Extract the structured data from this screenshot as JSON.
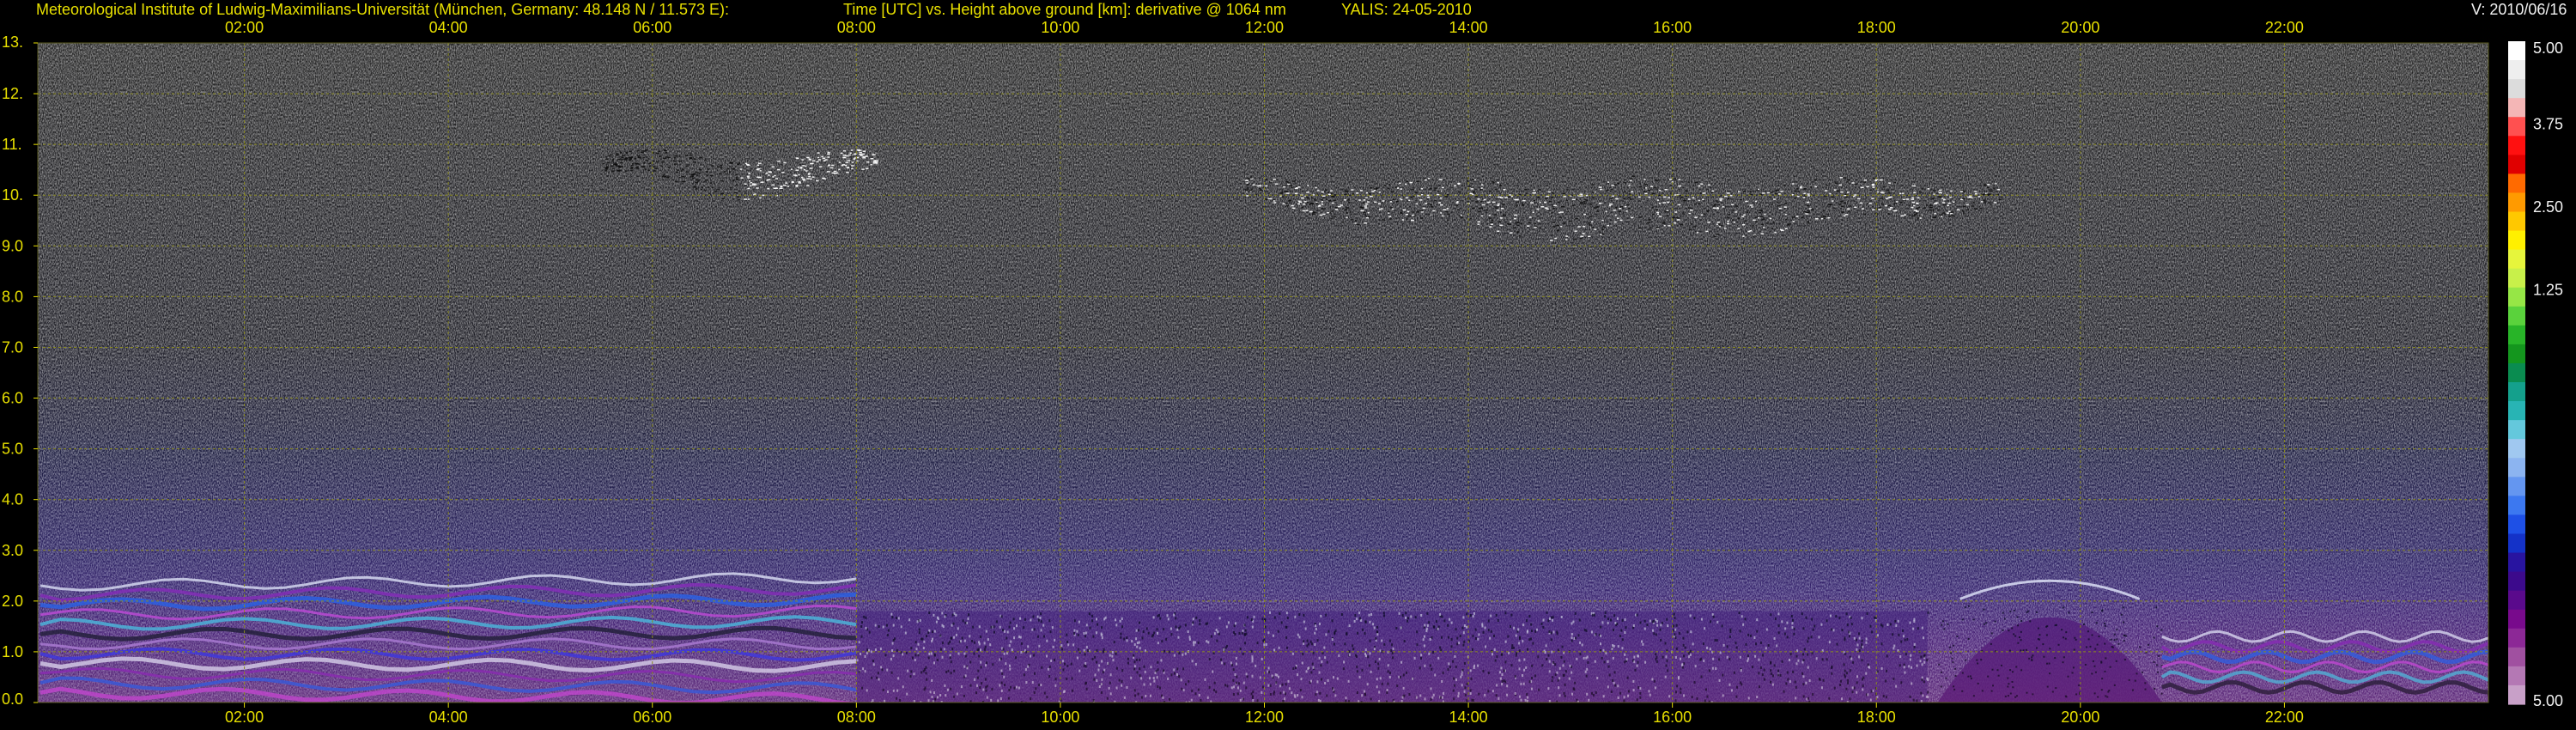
{
  "header": {
    "institute": "Meteorological Institute of Ludwig-Maximilians-Universität (München, Germany: 48.148 N / 11.573 E):",
    "title": "Time [UTC] vs. Height above ground [km]: derivative @ 1064 nm",
    "station": "YALIS: 24-05-2010",
    "version": "V: 2010/06/16"
  },
  "colors": {
    "background": "#000000",
    "label_yellow": "#e8e000",
    "grid_yellow": "#8a8a1e",
    "label_white": "#f2f2f2"
  },
  "chart_data": {
    "type": "heatmap",
    "title": "Time [UTC] vs. Height above ground [km]: derivative @ 1064 nm",
    "xlabel": "Time [UTC]",
    "ylabel": "Height above ground [km]",
    "x_unit": "hours UTC",
    "xlim": [
      0,
      24
    ],
    "ylim": [
      0,
      13
    ],
    "x_ticks": [
      {
        "value": 2,
        "label": "02:00"
      },
      {
        "value": 4,
        "label": "04:00"
      },
      {
        "value": 6,
        "label": "06:00"
      },
      {
        "value": 8,
        "label": "08:00"
      },
      {
        "value": 10,
        "label": "10:00"
      },
      {
        "value": 12,
        "label": "12:00"
      },
      {
        "value": 14,
        "label": "14:00"
      },
      {
        "value": 16,
        "label": "16:00"
      },
      {
        "value": 18,
        "label": "18:00"
      },
      {
        "value": 20,
        "label": "20:00"
      },
      {
        "value": 22,
        "label": "22:00"
      }
    ],
    "y_ticks": [
      {
        "value": 0,
        "label": "0.0"
      },
      {
        "value": 1,
        "label": "1.0"
      },
      {
        "value": 2,
        "label": "2.0"
      },
      {
        "value": 3,
        "label": "3.0"
      },
      {
        "value": 4,
        "label": "4.0"
      },
      {
        "value": 5,
        "label": "5.0"
      },
      {
        "value": 6,
        "label": "6.0"
      },
      {
        "value": 7,
        "label": "7.0"
      },
      {
        "value": 8,
        "label": "8.0"
      },
      {
        "value": 9,
        "label": "9.0"
      },
      {
        "value": 10,
        "label": "10."
      },
      {
        "value": 11,
        "label": "11."
      },
      {
        "value": 12,
        "label": "12."
      },
      {
        "value": 13,
        "label": "13."
      }
    ],
    "grid": true,
    "colorbar": {
      "range": [
        -5.0,
        5.0
      ],
      "tick_labels": [
        {
          "value": 5.0,
          "label": "5.00"
        },
        {
          "value": 3.75,
          "label": "3.75"
        },
        {
          "value": 2.5,
          "label": "2.50"
        },
        {
          "value": 1.25,
          "label": "1.25"
        },
        {
          "value": -5.0,
          "label": "5.00"
        }
      ],
      "colors": [
        "#ffffff",
        "#eeeeee",
        "#dcdcdc",
        "#f4b6b6",
        "#ff5050",
        "#ff1010",
        "#e00000",
        "#ff6a00",
        "#ff9a00",
        "#ffc800",
        "#fff000",
        "#e6f53c",
        "#c8f04a",
        "#96e646",
        "#5ad23c",
        "#28b428",
        "#14961e",
        "#0a8c50",
        "#14a08c",
        "#28b4b4",
        "#64c8dc",
        "#a0c8f0",
        "#8cb4f0",
        "#6496f0",
        "#3c78f0",
        "#1e50e6",
        "#1432c8",
        "#2814a0",
        "#3c0a8c",
        "#5a0a8c",
        "#780a8c",
        "#8c2896",
        "#a050a0",
        "#b478b4",
        "#c8a0c8"
      ]
    },
    "features": [
      {
        "name": "cirrus layer",
        "time_start": 5.5,
        "time_end": 8.2,
        "height_bottom": 9.8,
        "height_top": 11.3
      },
      {
        "name": "cirrus layer",
        "time_start": 11.8,
        "time_end": 19.2,
        "height_bottom": 8.9,
        "height_top": 11.0
      },
      {
        "name": "residual aerosol layers",
        "time_start": 0.0,
        "time_end": 8.0,
        "height_bottom": 0.1,
        "height_top": 2.4
      },
      {
        "name": "convective boundary layer",
        "time_start": 8.0,
        "time_end": 18.5,
        "height_bottom": 0.0,
        "height_top": 1.8
      },
      {
        "name": "evening aerosol dome",
        "time_start": 18.6,
        "time_end": 20.8,
        "height_bottom": 0.0,
        "height_top": 2.4
      },
      {
        "name": "nocturnal layers",
        "time_start": 20.8,
        "time_end": 24.0,
        "height_bottom": 0.2,
        "height_top": 1.4
      }
    ]
  }
}
